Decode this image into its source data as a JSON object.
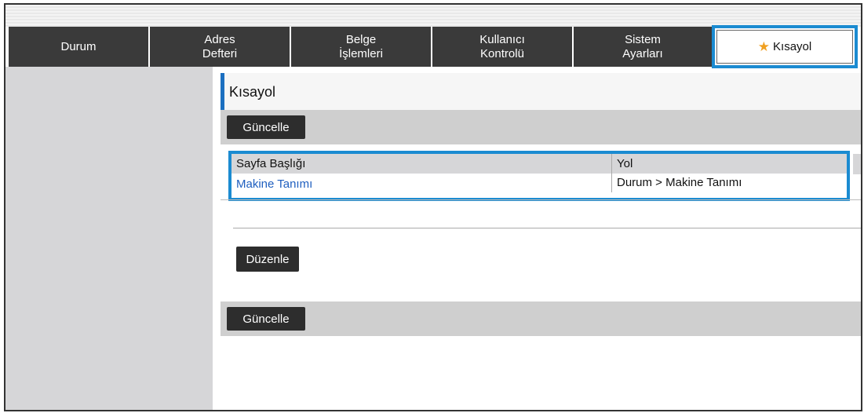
{
  "tabs": [
    {
      "label_line1": "Durum",
      "label_line2": ""
    },
    {
      "label_line1": "Adres",
      "label_line2": "Defteri"
    },
    {
      "label_line1": "Belge",
      "label_line2": "İşlemleri"
    },
    {
      "label_line1": "Kullanıcı",
      "label_line2": "Kontrolü"
    },
    {
      "label_line1": "Sistem",
      "label_line2": "Ayarları"
    },
    {
      "label_line1": "Kısayol",
      "label_line2": "",
      "icon": "star-icon",
      "active": true
    }
  ],
  "page": {
    "title": "Kısayol",
    "update_button_top": "Güncelle",
    "edit_button": "Düzenle",
    "update_button_bottom": "Güncelle"
  },
  "shortcut_table": {
    "columns": [
      "Sayfa Başlığı",
      "Yol"
    ],
    "rows": [
      {
        "title": "Makine Tanımı",
        "path": "Durum >  Makine Tanımı"
      }
    ]
  },
  "colors": {
    "tab_bg": "#3a3a3a",
    "highlight": "#1b8bd1",
    "link": "#1f5fbf",
    "star": "#f0a020"
  }
}
